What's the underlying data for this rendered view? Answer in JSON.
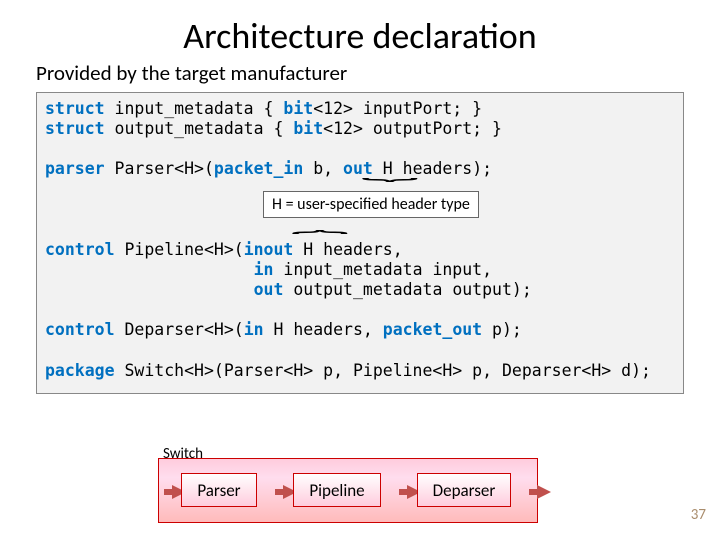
{
  "title": "Architecture declaration",
  "subtitle": "Provided by the target manufacturer",
  "code": {
    "l1a": "struct",
    "l1b": " input_metadata { ",
    "l1c": "bit",
    "l1d": "<12> inputPort; }",
    "l2a": "struct",
    "l2b": " output_metadata { ",
    "l2c": "bit",
    "l2d": "<12> outputPort; }",
    "l3a": "parser",
    "l3b": " Parser<H>(",
    "l3c": "packet_in",
    "l3d": " b, ",
    "l3e": "out",
    "l3f": " H headers);",
    "l4a": "control",
    "l4b": " Pipeline<H>(",
    "l4c": "inout",
    "l4d": " H headers,",
    "l5a": "                     ",
    "l5b": "in",
    "l5c": " input_metadata input,",
    "l6a": "                     ",
    "l6b": "out",
    "l6c": " output_metadata output);",
    "l7a": "control",
    "l7b": " Deparser<H>(",
    "l7c": "in",
    "l7d": " H headers, ",
    "l7e": "packet_out",
    "l7f": " p);",
    "l8a": "package",
    "l8b": " Switch<H>(Parser<H> p, Pipeline<H> p, Deparser<H> d);"
  },
  "callout": "H = user-specified header type",
  "switch": {
    "label": "Switch",
    "s1": "Parser",
    "s2": "Pipeline",
    "s3": "Deparser"
  },
  "page": "37"
}
